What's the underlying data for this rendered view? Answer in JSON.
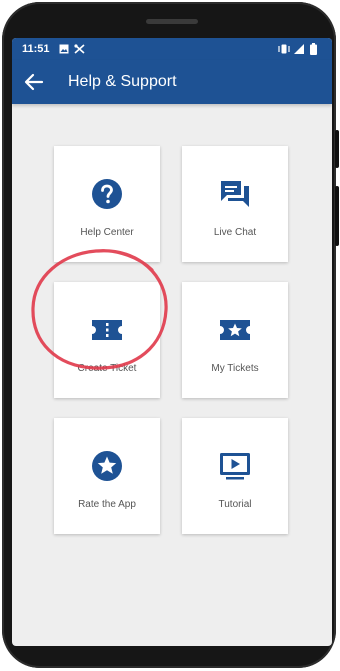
{
  "status_bar": {
    "time": "11:51"
  },
  "app_bar": {
    "title": "Help & Support",
    "back_icon": "arrow-left-icon"
  },
  "colors": {
    "brand": "#1e5294",
    "background": "#eeeeee",
    "annotation": "#e0394a"
  },
  "tiles": [
    {
      "label": "Help Center",
      "icon": "help-circle-icon"
    },
    {
      "label": "Live Chat",
      "icon": "chat-icon"
    },
    {
      "label": "Create Ticket",
      "icon": "ticket-icon"
    },
    {
      "label": "My Tickets",
      "icon": "ticket-star-icon"
    },
    {
      "label": "Rate the App",
      "icon": "star-circle-icon"
    },
    {
      "label": "Tutorial",
      "icon": "play-screen-icon"
    }
  ]
}
